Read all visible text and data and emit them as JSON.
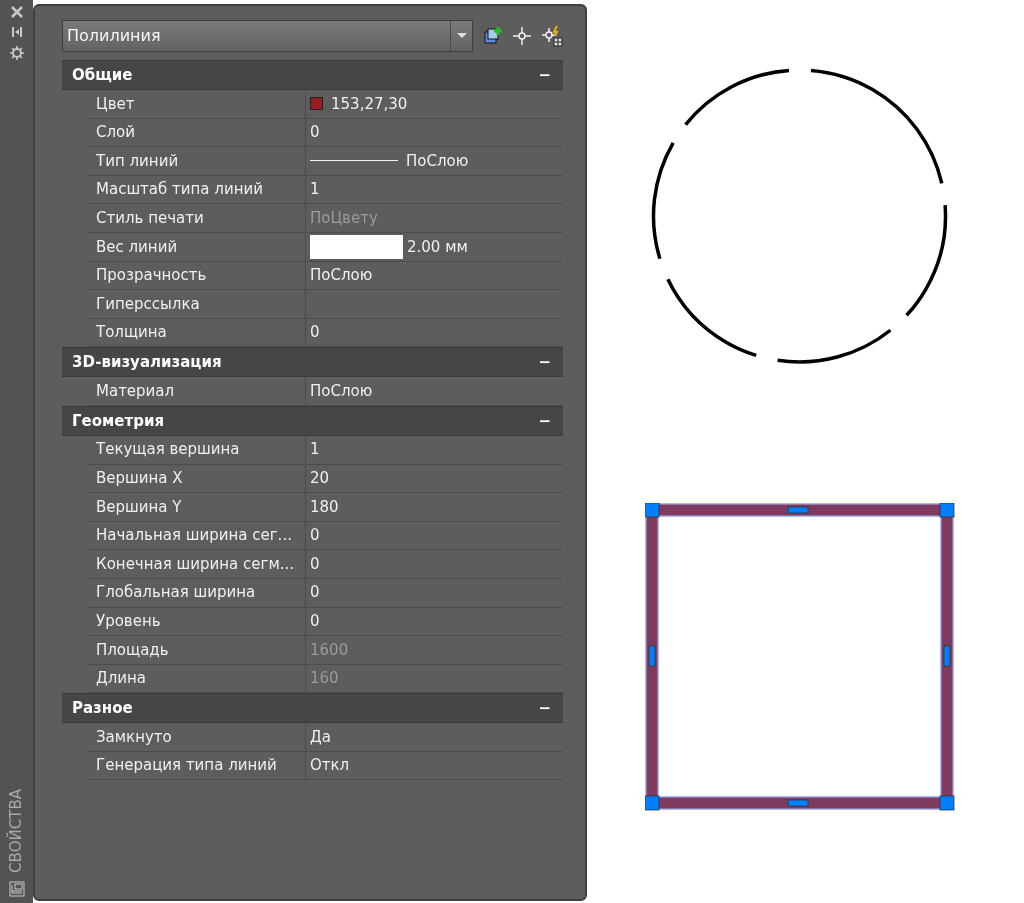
{
  "palette": {
    "title": "СВОЙСТВА"
  },
  "object_selector": {
    "value": "Полилиния"
  },
  "sections": [
    {
      "title": "Общие",
      "expanded": true,
      "toggle": "−",
      "rows": [
        {
          "label": "Цвет",
          "kind": "color",
          "color": "#991b1e",
          "value": "153,27,30"
        },
        {
          "label": "Слой",
          "kind": "text",
          "value": "0"
        },
        {
          "label": "Тип линий",
          "kind": "linetype",
          "value": "ПоСлою"
        },
        {
          "label": "Масштаб типа линий",
          "kind": "text",
          "value": "1"
        },
        {
          "label": "Стиль печати",
          "kind": "readonly",
          "value": "ПоЦвету"
        },
        {
          "label": "Вес линий",
          "kind": "lineweight",
          "value": "2.00 мм"
        },
        {
          "label": "Прозрачность",
          "kind": "text",
          "value": "ПоСлою"
        },
        {
          "label": "Гиперссылка",
          "kind": "empty"
        },
        {
          "label": "Толщина",
          "kind": "text",
          "value": "0"
        }
      ]
    },
    {
      "title": "3D-визуализация",
      "expanded": true,
      "toggle": "−",
      "rows": [
        {
          "label": "Материал",
          "kind": "text",
          "value": "ПоСлою"
        }
      ]
    },
    {
      "title": "Геометрия",
      "expanded": true,
      "toggle": "−",
      "rows": [
        {
          "label": "Текущая вершина",
          "kind": "text",
          "value": "1"
        },
        {
          "label": "Вершина X",
          "kind": "text",
          "value": "20"
        },
        {
          "label": "Вершина Y",
          "kind": "text",
          "value": "180"
        },
        {
          "label": "Начальная ширина сег...",
          "kind": "text",
          "value": "0"
        },
        {
          "label": "Конечная ширина сегм...",
          "kind": "text",
          "value": "0"
        },
        {
          "label": "Глобальная ширина",
          "kind": "text",
          "value": "0"
        },
        {
          "label": "Уровень",
          "kind": "text",
          "value": "0"
        },
        {
          "label": "Площадь",
          "kind": "readonly",
          "value": "1600"
        },
        {
          "label": "Длина",
          "kind": "readonly",
          "value": "160"
        }
      ]
    },
    {
      "title": "Разное",
      "expanded": true,
      "toggle": "−",
      "rows": [
        {
          "label": "Замкнуто",
          "kind": "text",
          "value": "Да"
        },
        {
          "label": "Генерация типа линий",
          "kind": "text",
          "value": "Откл"
        }
      ]
    }
  ]
}
